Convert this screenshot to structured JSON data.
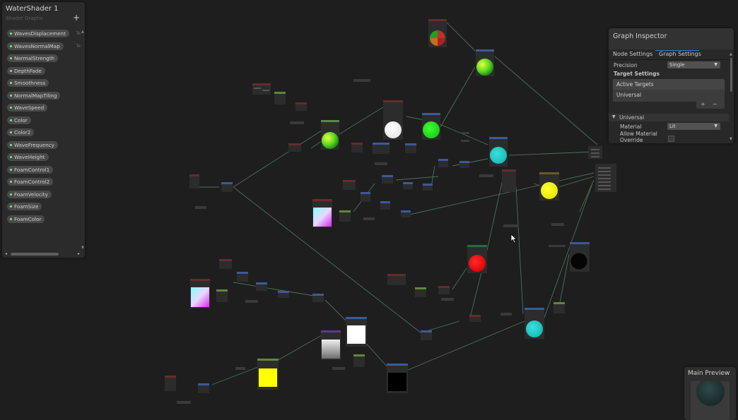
{
  "window": {
    "title": "WaterShader 1",
    "subtitle": "Shader Graphs",
    "add_label": "+"
  },
  "blackboard": {
    "properties": [
      {
        "label": "WavesDisplacement",
        "type": "Te"
      },
      {
        "label": "WavesNormalMap",
        "type": "Te"
      },
      {
        "label": "NormalStrength",
        "type": ""
      },
      {
        "label": "DepthFade",
        "type": ""
      },
      {
        "label": "Smoothness",
        "type": ""
      },
      {
        "label": "NormalMapTiling",
        "type": ""
      },
      {
        "label": "WaveSpeed",
        "type": ""
      },
      {
        "label": "Color",
        "type": ""
      },
      {
        "label": "Color2",
        "type": ""
      },
      {
        "label": "WaveFrequency",
        "type": ""
      },
      {
        "label": "WaveHeight",
        "type": ""
      },
      {
        "label": "FoamControl1",
        "type": ""
      },
      {
        "label": "FoamControl2",
        "type": ""
      },
      {
        "label": "FoamVelocity",
        "type": ""
      },
      {
        "label": "FoamSize",
        "type": ""
      },
      {
        "label": "FoamColor",
        "type": ""
      }
    ]
  },
  "inspector": {
    "title": "Graph Inspector",
    "tabs": [
      "Node Settings",
      "Graph Settings"
    ],
    "active_tab": "Graph Settings",
    "precision_label": "Precision",
    "precision_value": "Single",
    "target_settings_label": "Target Settings",
    "active_targets_label": "Active Targets",
    "target_item": "Universal",
    "add_label": "+",
    "remove_label": "−",
    "section_label": "Universal",
    "material_label": "Material",
    "material_value": "Lit",
    "allow_override_label": "Allow Material Override",
    "allow_override_checked": false
  },
  "main_preview": {
    "title": "Main Preview"
  },
  "preview_colors": {
    "accent_tab": "#3d7fd6",
    "property_dot": "#84e4a0",
    "edge": "#4e6f5a",
    "canvas_bg": "#1e1e1e"
  },
  "graph_nodes": [
    {
      "id": "n-red-green-sphere",
      "preview": "red-green-sphere"
    },
    {
      "id": "n-green-yellow-sphere-top",
      "preview": "green-yellow-sphere"
    },
    {
      "id": "n-green-yellow-sphere-mid",
      "preview": "green-yellow-sphere"
    },
    {
      "id": "n-white-sphere",
      "preview": "white-sphere"
    },
    {
      "id": "n-green-sphere",
      "preview": "green-sphere"
    },
    {
      "id": "n-cyan-sphere-top",
      "preview": "cyan-sphere"
    },
    {
      "id": "n-yellow-sphere",
      "preview": "yellow-sphere"
    },
    {
      "id": "n-gradient-square-1",
      "preview": "uv-gradient-square"
    },
    {
      "id": "n-red-sphere",
      "preview": "red-sphere"
    },
    {
      "id": "n-black-sphere",
      "preview": "black-sphere"
    },
    {
      "id": "n-gradient-square-2",
      "preview": "uv-gradient-square"
    },
    {
      "id": "n-white-square",
      "preview": "white-square"
    },
    {
      "id": "n-gray-gradient",
      "preview": "gray-gradient-square"
    },
    {
      "id": "n-cyan-sphere-bottom",
      "preview": "cyan-sphere"
    },
    {
      "id": "n-yellow-square",
      "preview": "yellow-square"
    },
    {
      "id": "n-black-square",
      "preview": "black-square"
    }
  ]
}
